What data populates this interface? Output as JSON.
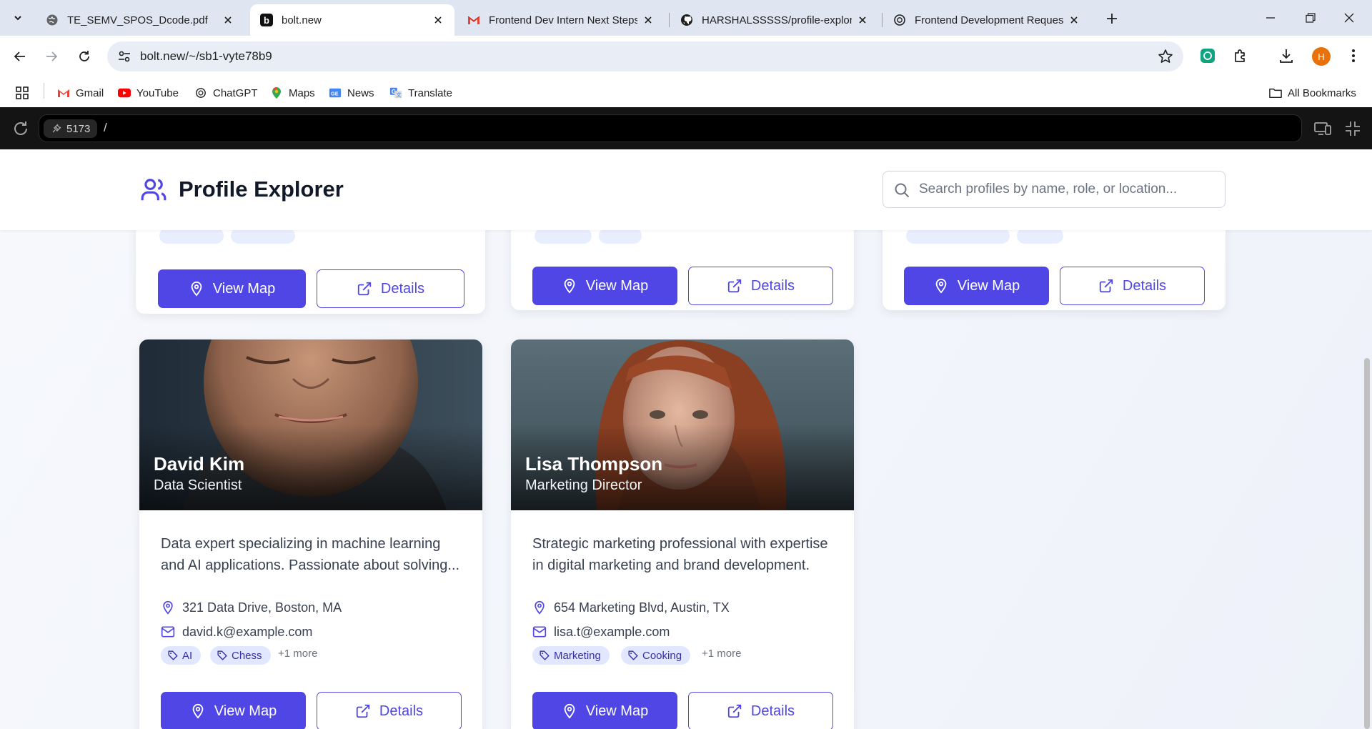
{
  "browser": {
    "tabs": [
      {
        "title": "TE_SEMV_SPOS_Dcode.pdf"
      },
      {
        "title": "bolt.new"
      },
      {
        "title": "Frontend Dev Intern Next Steps"
      },
      {
        "title": "HARSHALSSSSS/profile-explorer"
      },
      {
        "title": "Frontend Development Request"
      }
    ],
    "url": "bolt.new/~/sb1-vyte78b9",
    "profile_initial": "H",
    "bookmarks": [
      "Gmail",
      "YouTube",
      "ChatGPT",
      "Maps",
      "News",
      "Translate"
    ],
    "all_bookmarks": "All Bookmarks"
  },
  "preview": {
    "port": "5173",
    "path": "/"
  },
  "app": {
    "title": "Profile Explorer",
    "search_placeholder": "Search profiles by name, role, or location...",
    "view_map": "View Map",
    "details": "Details",
    "profiles": [
      {
        "name": "David Kim",
        "role": "Data Scientist",
        "description": "Data expert specializing in machine learning and AI applications. Passionate about solving...",
        "address": "321 Data Drive, Boston, MA",
        "email": "david.k@example.com",
        "tags": [
          "AI",
          "Chess"
        ],
        "more": "+1 more"
      },
      {
        "name": "Lisa Thompson",
        "role": "Marketing Director",
        "description": "Strategic marketing professional with expertise in digital marketing and brand development.",
        "address": "654 Marketing Blvd, Austin, TX",
        "email": "lisa.t@example.com",
        "tags": [
          "Marketing",
          "Cooking"
        ],
        "more": "+1 more"
      }
    ]
  },
  "colors": {
    "accent": "#4f46e5",
    "tag_bg": "#e0e7ff",
    "tag_text": "#3730a3"
  }
}
